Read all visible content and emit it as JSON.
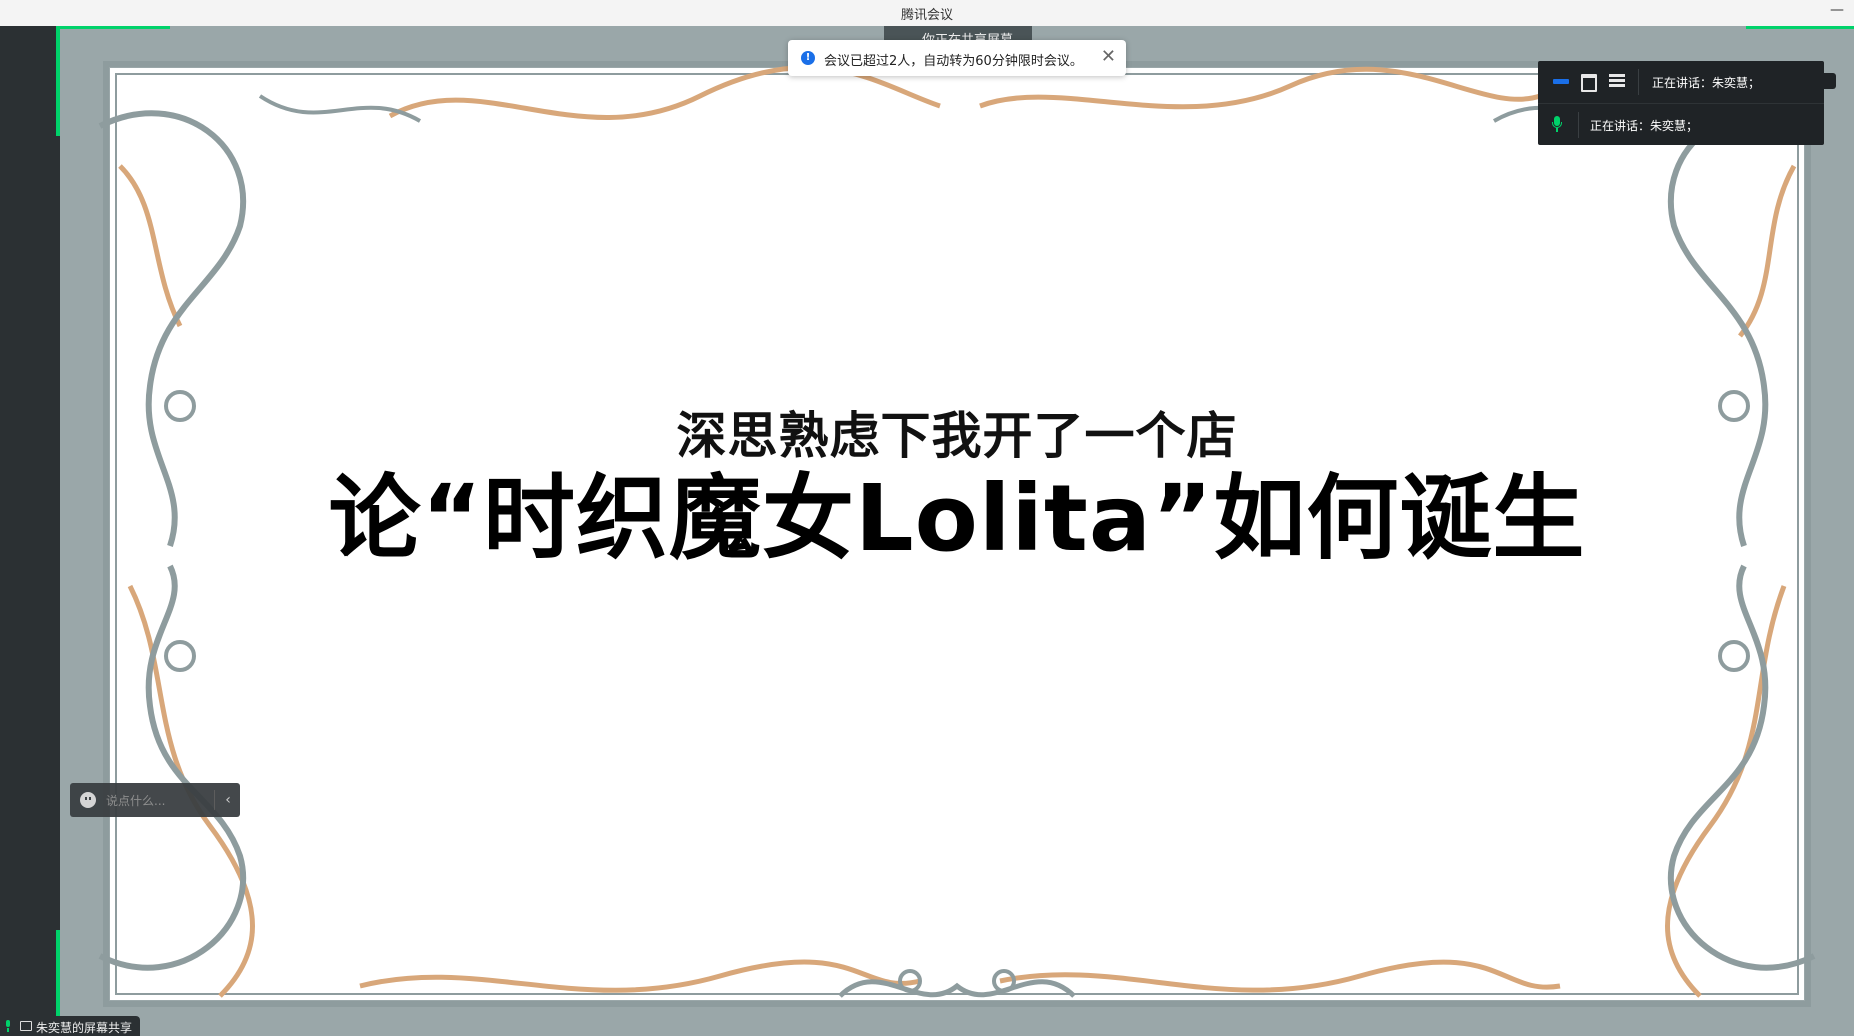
{
  "window": {
    "title": "腾讯会议",
    "minimize_glyph": "—"
  },
  "share_tab": {
    "label": "你正在共享屏幕"
  },
  "toast": {
    "icon": "info-icon",
    "message": "会议已超过2人，自动转为60分钟限时会议。",
    "close_glyph": "✕"
  },
  "speaker_panel": {
    "view_buttons": [
      "speaker-view-icon",
      "gallery-view-icon",
      "list-view-icon"
    ],
    "speaking_label_top": "正在讲话：朱奕慧；",
    "speaking_label_bottom": "正在讲话：朱奕慧；"
  },
  "slide": {
    "subtitle": "深思熟虑下我开了一个店",
    "title": "论“时织魔女Lolita”如何诞生"
  },
  "chat": {
    "placeholder": "说点什么...",
    "collapse_glyph": "‹"
  },
  "bottom_label": {
    "text": "朱奕慧的屏幕共享"
  },
  "colors": {
    "accent_green": "#00d26a",
    "accent_blue": "#1a6fe8",
    "frame_gray": "#9aa7a9",
    "frame_orange": "#d8a77a"
  }
}
